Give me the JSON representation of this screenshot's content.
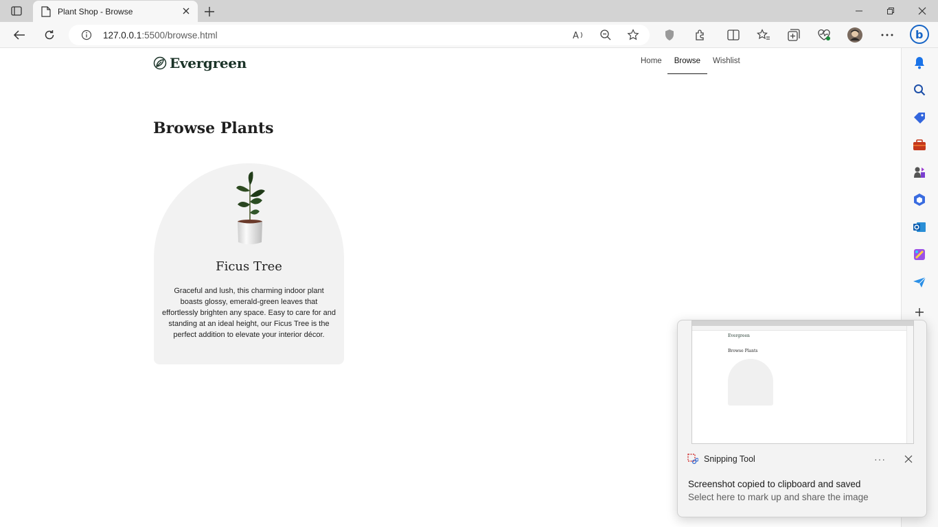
{
  "browser": {
    "tab_title": "Plant Shop - Browse",
    "url_host": "127.0.0.1",
    "url_rest": ":5500/browse.html"
  },
  "site": {
    "brand": "Evergreen",
    "nav": {
      "home": "Home",
      "browse": "Browse",
      "wishlist": "Wishlist"
    },
    "active_nav": "Browse"
  },
  "main": {
    "title": "Browse Plants",
    "products": [
      {
        "name": "Ficus Tree",
        "description": "Graceful and lush, this charming indoor plant boasts glossy, emerald-green leaves that effortlessly brighten any space. Easy to care for and standing at an ideal height, our Ficus Tree is the perfect addition to elevate your interior décor."
      }
    ]
  },
  "toast": {
    "app": "Snipping Tool",
    "more": "···",
    "message": "Screenshot copied to clipboard and saved",
    "sub": "Select here to mark up and share the image",
    "thumb_brand": "Evergreen",
    "thumb_title": "Browse Plants"
  },
  "colors": {
    "brand_green": "#1b3328",
    "card_bg": "#f2f2f2",
    "accent_blue": "#0f6cbd"
  }
}
